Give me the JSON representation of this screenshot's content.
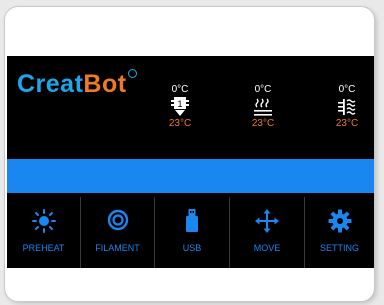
{
  "brand": {
    "logo_part1": "Creat",
    "logo_part2": "Bot"
  },
  "temperatures": [
    {
      "icon": "extruder-icon",
      "target": "0°C",
      "current": "23°C",
      "badge": "1"
    },
    {
      "icon": "heated-bed-icon",
      "target": "0°C",
      "current": "23°C"
    },
    {
      "icon": "chamber-fan-icon",
      "target": "0°C",
      "current": "23°C"
    }
  ],
  "status_bar": {
    "text": ""
  },
  "menu": [
    {
      "label": "PREHEAT",
      "icon": "sun-icon"
    },
    {
      "label": "FILAMENT",
      "icon": "filament-spool-icon"
    },
    {
      "label": "USB",
      "icon": "usb-drive-icon"
    },
    {
      "label": "MOVE",
      "icon": "move-arrows-icon"
    },
    {
      "label": "SETTING",
      "icon": "gear-icon"
    }
  ],
  "colors": {
    "accent": "#1a86f0",
    "orange": "#f07a22",
    "logo_blue": "#1aa7ec",
    "background": "#000000"
  }
}
